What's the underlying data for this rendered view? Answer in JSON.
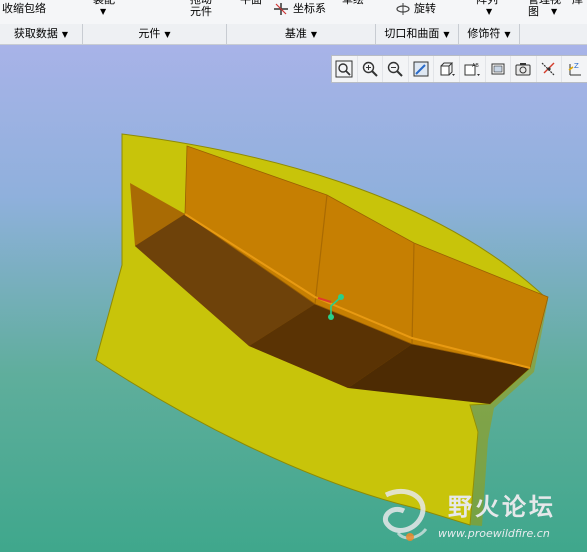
{
  "ribbon": {
    "top_items": [
      {
        "label": "收缩包络"
      },
      {
        "label": "装配"
      },
      {
        "label": "拖动\n元件"
      },
      {
        "label": "平面"
      },
      {
        "label": "坐标系"
      },
      {
        "label": "草绘"
      },
      {
        "label": "旋转"
      },
      {
        "label": "阵列"
      },
      {
        "label": "管理视\n图"
      },
      {
        "label": "库"
      }
    ]
  },
  "groups": [
    {
      "label": "获取数据"
    },
    {
      "label": "元件"
    },
    {
      "label": "基准"
    },
    {
      "label": "切口和曲面"
    },
    {
      "label": "修饰符"
    }
  ],
  "view_toolbar": {
    "buttons": [
      "zoom-fit-icon",
      "zoom-in-icon",
      "zoom-out-icon",
      "repaint-icon",
      "display-style-icon",
      "saved-views-icon",
      "annotation-display-icon",
      "camera-icon",
      "datum-display-icon",
      "spin-center-icon"
    ]
  },
  "watermark": {
    "name": "野火论坛",
    "url": "www.proewildfire.cn"
  },
  "colors": {
    "surface_yellow": "#c8c40a",
    "body_orange": "#c67f02",
    "body_dark": "#5a3304",
    "bg_top": "#a8b3e8",
    "bg_bottom": "#3fa78c"
  }
}
